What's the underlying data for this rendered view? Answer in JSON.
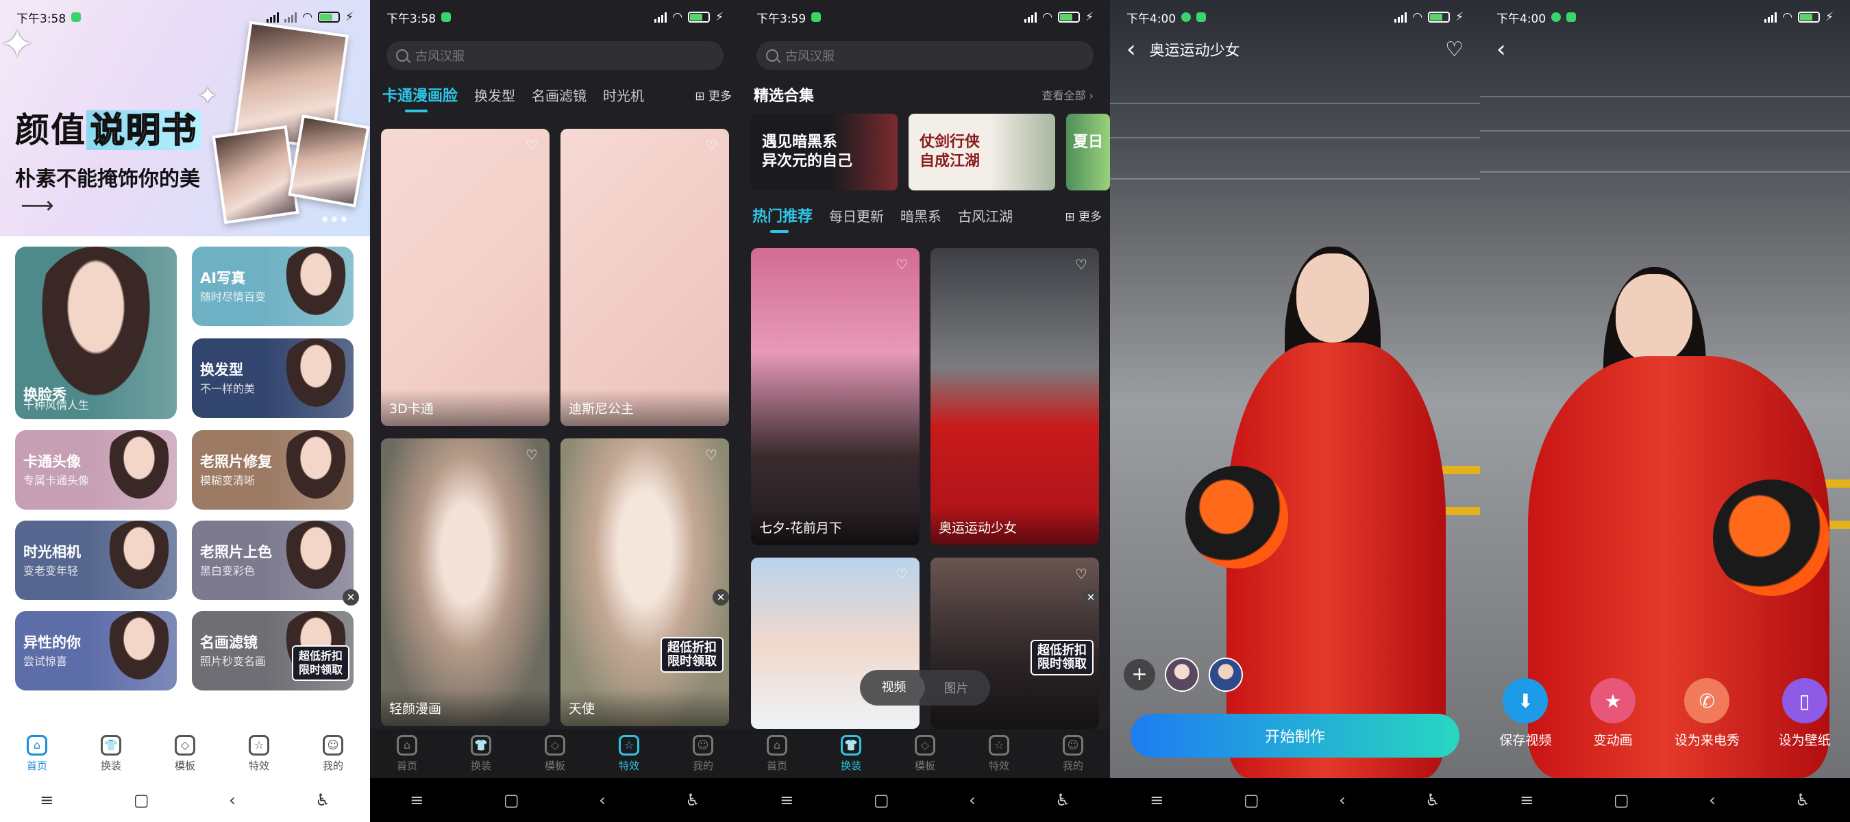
{
  "status": {
    "time1": "下午3:58",
    "time2": "下午3:58",
    "time3": "下午3:59",
    "time4": "下午4:00",
    "time5": "下午4:00"
  },
  "tabs": [
    "首页",
    "换装",
    "模板",
    "特效",
    "我的"
  ],
  "screen1": {
    "banner_title_a": "颜值",
    "banner_title_b": "说明书",
    "banner_subtitle": "朴素不能掩饰你的美",
    "features": [
      {
        "title": "换脸秀",
        "sub": "千种风情人生",
        "color": "#4f8a8a"
      },
      {
        "title": "AI写真",
        "sub": "随时尽情百变",
        "color": "#6fb1c4"
      },
      {
        "title": "换发型",
        "sub": "不一样的美",
        "color": "#32456f"
      },
      {
        "title": "卡通头像",
        "sub": "专属卡通头像",
        "color": "#c79fb4"
      },
      {
        "title": "老照片修复",
        "sub": "模糊变清晰",
        "color": "#9c7a63"
      },
      {
        "title": "时光相机",
        "sub": "变老变年轻",
        "color": "#56678f"
      },
      {
        "title": "老照片上色",
        "sub": "黑白变彩色",
        "color": "#7d7a90"
      },
      {
        "title": "异性的你",
        "sub": "尝试惊喜",
        "color": "#5d6da8"
      },
      {
        "title": "名画滤镜",
        "sub": "照片秒变名画",
        "color": "#6e6e74"
      }
    ],
    "promo": "超低折扣\n限时领取"
  },
  "screen2": {
    "search_placeholder": "古风汉服",
    "categories": [
      "卡通漫画脸",
      "换发型",
      "名画滤镜",
      "时光机"
    ],
    "more": "更多",
    "cards": [
      "3D卡通",
      "迪斯尼公主",
      "轻颜漫画",
      "天使"
    ],
    "promo": "超低折扣\n限时领取"
  },
  "screen3": {
    "search_placeholder": "古风汉服",
    "section_title": "精选合集",
    "view_all": "查看全部",
    "collections": [
      "遇见暗黑系\n异次元的自己",
      "仗剑行侠\n自成江湖",
      "夏日"
    ],
    "categories": [
      "热门推荐",
      "每日更新",
      "暗黑系",
      "古风江湖"
    ],
    "more": "更多",
    "cards": [
      "七夕-花前月下",
      "奥运运动少女",
      "",
      ""
    ],
    "toggle": [
      "视频",
      "图片"
    ],
    "promo": "超低折扣\n限时领取"
  },
  "screen4": {
    "title": "奥运运动少女",
    "start": "开始制作"
  },
  "screen5": {
    "actions": [
      {
        "label": "保存视频",
        "icon": "download-icon",
        "color": "#1e9be8"
      },
      {
        "label": "变动画",
        "icon": "magic-icon",
        "color": "#e8567a"
      },
      {
        "label": "设为来电秀",
        "icon": "phone-icon",
        "color": "#f07a5a"
      },
      {
        "label": "设为壁纸",
        "icon": "wallpaper-icon",
        "color": "#8d5be6"
      }
    ]
  }
}
